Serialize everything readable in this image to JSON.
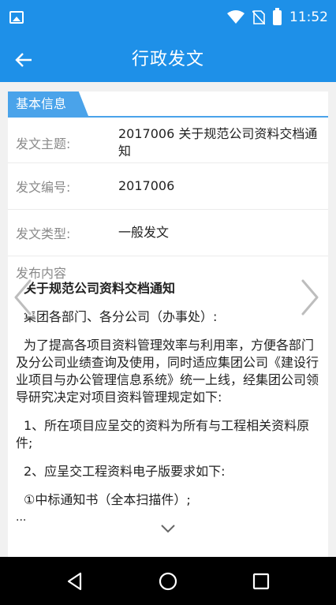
{
  "status_bar": {
    "time": "11:52"
  },
  "app_bar": {
    "title": "行政发文"
  },
  "section": {
    "title": "基本信息"
  },
  "fields": {
    "subject": {
      "label": "发文主题:",
      "value": "2017006 关于规范公司资料交档通知"
    },
    "number": {
      "label": "发文编号:",
      "value": "2017006"
    },
    "type": {
      "label": "发文类型:",
      "value": "一般发文"
    }
  },
  "publish": {
    "label": "发布内容",
    "paragraphs": [
      "关于规范公司资料交档通知",
      "集团各部门、各分公司（办事处）:",
      "为了提高各项目资料管理效率与利用率，方便各部门及分公司业绩查询及使用，同时适应集团公司《建设行业项目与办公管理信息系统》统一上线，经集团公司领导研究决定对项目资料管理规定如下:",
      "1、所在项目应呈交的资料为所有与工程相关资料原件;",
      "2、应呈交工程资料电子版要求如下:",
      "①中标通知书（全本扫描件）;"
    ],
    "ellipsis": "..."
  },
  "colors": {
    "primary": "#1e90e8",
    "section_tab": "#4aa3ea"
  }
}
